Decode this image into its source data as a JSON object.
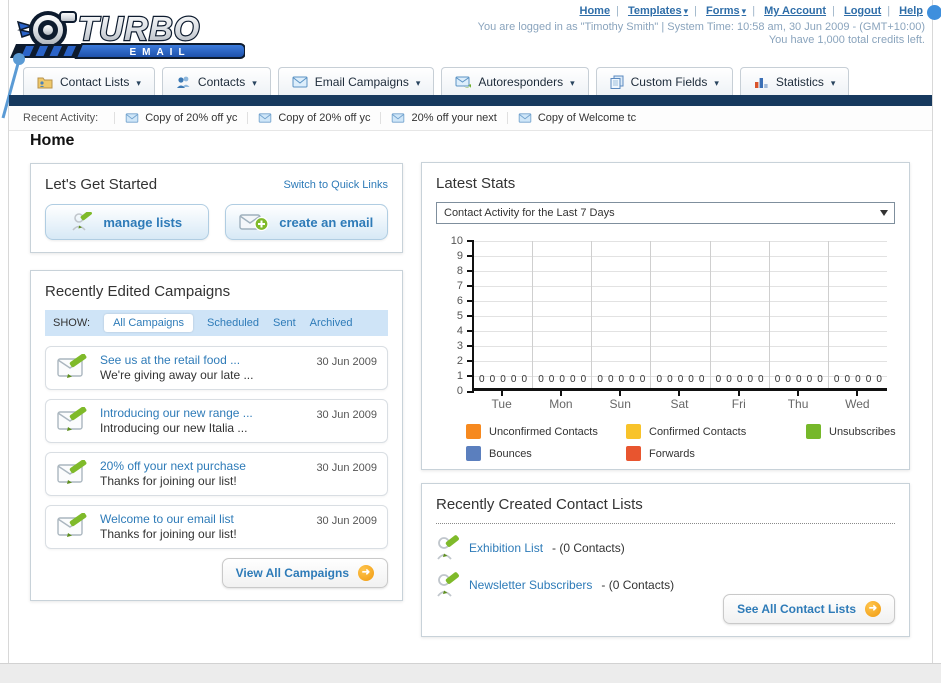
{
  "header": {
    "logo_title": "TURBO",
    "logo_subtitle": "E M A I L",
    "nav_links": {
      "home": "Home",
      "templates": "Templates",
      "forms": "Forms",
      "my_account": "My Account",
      "logout": "Logout",
      "help": "Help"
    },
    "login_info": "You are logged in as \"Timothy Smith\" | System Time: 10:58 am, 30 Jun 2009 - (GMT+10:00)",
    "credits_info": "You have 1,000 total credits left."
  },
  "nav_tabs": [
    {
      "label": "Contact Lists",
      "icon": "folder-user-icon"
    },
    {
      "label": "Contacts",
      "icon": "people-icon"
    },
    {
      "label": "Email Campaigns",
      "icon": "envelope-icon"
    },
    {
      "label": "Autoresponders",
      "icon": "envelope-arrow-icon"
    },
    {
      "label": "Custom Fields",
      "icon": "pages-icon"
    },
    {
      "label": "Statistics",
      "icon": "bar-chart-icon"
    }
  ],
  "recent_activity": {
    "label": "Recent Activity:",
    "items": [
      {
        "text": "Copy of 20% off yc"
      },
      {
        "text": "Copy of 20% off yc"
      },
      {
        "text": "20% off your next "
      },
      {
        "text": "Copy of Welcome tc"
      }
    ]
  },
  "page_title": "Home",
  "get_started": {
    "title": "Let's Get Started",
    "switch_link": "Switch to Quick Links",
    "manage_lists_label": "manage lists",
    "create_email_label": "create an email"
  },
  "campaigns": {
    "title": "Recently Edited Campaigns",
    "show_label": "SHOW:",
    "tabs": [
      {
        "label": "All Campaigns",
        "active": true
      },
      {
        "label": "Scheduled",
        "active": false
      },
      {
        "label": "Sent",
        "active": false
      },
      {
        "label": "Archived",
        "active": false
      }
    ],
    "items": [
      {
        "title": "See us at the retail food ...",
        "subtitle": "We're giving away our late ...",
        "date": "30 Jun 2009"
      },
      {
        "title": "Introducing our new range ...",
        "subtitle": "Introducing our new Italia ...",
        "date": "30 Jun 2009"
      },
      {
        "title": "20% off your next purchase",
        "subtitle": "Thanks for joining our list!",
        "date": "30 Jun 2009"
      },
      {
        "title": "Welcome to our email list",
        "subtitle": "Thanks for joining our list!",
        "date": "30 Jun 2009"
      }
    ],
    "view_all_label": "View All Campaigns"
  },
  "stats": {
    "title": "Latest Stats",
    "dropdown_value": "Contact Activity for the Last 7 Days",
    "legend": [
      {
        "label": "Unconfirmed Contacts",
        "color": "#f6891f"
      },
      {
        "label": "Confirmed Contacts",
        "color": "#f8c32a"
      },
      {
        "label": "Unsubscribes",
        "color": "#76b82a"
      },
      {
        "label": "Bounces",
        "color": "#5b7fbe"
      },
      {
        "label": "Forwards",
        "color": "#e8552f"
      }
    ]
  },
  "chart_data": {
    "type": "bar",
    "title": "Contact Activity for the Last 7 Days",
    "categories": [
      "Tue",
      "Mon",
      "Sun",
      "Sat",
      "Fri",
      "Thu",
      "Wed"
    ],
    "series": [
      {
        "name": "Unconfirmed Contacts",
        "values": [
          0,
          0,
          0,
          0,
          0,
          0,
          0
        ]
      },
      {
        "name": "Confirmed Contacts",
        "values": [
          0,
          0,
          0,
          0,
          0,
          0,
          0
        ]
      },
      {
        "name": "Unsubscribes",
        "values": [
          0,
          0,
          0,
          0,
          0,
          0,
          0
        ]
      },
      {
        "name": "Bounces",
        "values": [
          0,
          0,
          0,
          0,
          0,
          0,
          0
        ]
      },
      {
        "name": "Forwards",
        "values": [
          0,
          0,
          0,
          0,
          0,
          0,
          0
        ]
      }
    ],
    "ylim": [
      0,
      10
    ],
    "yticks": [
      0,
      1,
      2,
      3,
      4,
      5,
      6,
      7,
      8,
      9,
      10
    ],
    "grid": true,
    "legend_position": "bottom"
  },
  "contact_lists": {
    "title": "Recently Created Contact Lists",
    "items": [
      {
        "name": "Exhibition List",
        "detail": "- (0 Contacts)"
      },
      {
        "name": "Newsletter Subscribers",
        "detail": "- (0 Contacts)"
      }
    ],
    "see_all_label": "See All Contact Lists"
  }
}
